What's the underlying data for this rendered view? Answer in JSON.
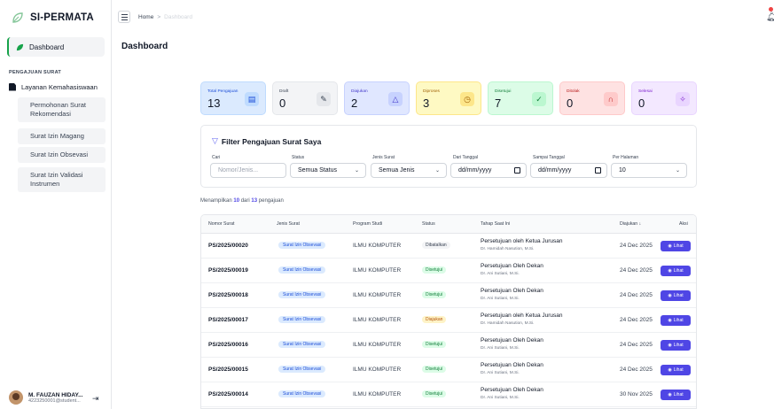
{
  "app": {
    "title": "SI-PERMATA"
  },
  "colors": {
    "primary": "#4f46e5",
    "brand": "#16a34a"
  },
  "sidebar": {
    "dashboard_label": "Dashboard",
    "section_label": "PENGAJUAN SURAT",
    "parent_label": "Layanan Kemahasiswaan",
    "sub_items": [
      {
        "label": "Permohonan Surat Rekomendasi"
      },
      {
        "label": "Surat Izin Magang"
      },
      {
        "label": "Surat Izin Obsevasi"
      },
      {
        "label": "Surat Izin Validasi Instrumen"
      }
    ],
    "user": {
      "name": "M. FAUZAN HIDAY...",
      "email": "4223250001@student..."
    }
  },
  "topbar": {
    "crumb_home": "Home",
    "crumb_sep": ">",
    "crumb_current": "Dashboard"
  },
  "page_title": "Dashboard",
  "stats": [
    {
      "label": "Total Pengajuan",
      "value": "13",
      "icon": "document-icon"
    },
    {
      "label": "Draft",
      "value": "0",
      "icon": "edit-icon"
    },
    {
      "label": "Diajukan",
      "value": "2",
      "icon": "warning-icon"
    },
    {
      "label": "Diproses",
      "value": "3",
      "icon": "clock-icon"
    },
    {
      "label": "Disetujui",
      "value": "7",
      "icon": "check-circle-icon"
    },
    {
      "label": "Ditolak",
      "value": "0",
      "icon": "reject-icon"
    },
    {
      "label": "Selesai",
      "value": "0",
      "icon": "sparkle-icon"
    }
  ],
  "filter": {
    "title": "Filter Pengajuan Surat Saya",
    "cari_label": "Cari",
    "cari_placeholder": "Nomor/Jenis...",
    "status_label": "Status",
    "status_value": "Semua Status",
    "jenis_label": "Jenis Surat",
    "jenis_value": "Semua Jenis",
    "dari_label": "Dari Tanggal",
    "dari_value": "dd/mm/yyyy",
    "sampai_label": "Sampai Tanggal",
    "sampai_value": "dd/mm/yyyy",
    "per_label": "Per Halaman",
    "per_value": "10"
  },
  "summary": {
    "prefix": "Menampilkan",
    "shown": "10",
    "mid": "dari",
    "total": "13",
    "suffix": "pengajuan"
  },
  "table": {
    "headers": [
      "Nomor Surat",
      "Jenis Surat",
      "Program Studi",
      "Status",
      "Tahap Saat Ini",
      "Diajukan ↓",
      "Aksi"
    ],
    "action_label": "Lihat",
    "rows": [
      {
        "no": "PS/2025/00020",
        "jenis": "Surat Izin Obsevasi",
        "prodi": "ILMU KOMPUTER",
        "status": "Dibatalkan",
        "tahap": "Persetujuan oleh Ketua Jurusan",
        "pj": "Dr. Hamidah Nasution, M.Si.",
        "tgl": "24 Dec 2025"
      },
      {
        "no": "PS/2025/00019",
        "jenis": "Surat Izin Obsevasi",
        "prodi": "ILMU KOMPUTER",
        "status": "Disetujui",
        "tahap": "Persetujuan Oleh Dekan",
        "pj": "Dr. Ani Sutiani, M.Si.",
        "tgl": "24 Dec 2025"
      },
      {
        "no": "PS/2025/00018",
        "jenis": "Surat Izin Obsevasi",
        "prodi": "ILMU KOMPUTER",
        "status": "Disetujui",
        "tahap": "Persetujuan Oleh Dekan",
        "pj": "Dr. Ani Sutiani, M.Si.",
        "tgl": "24 Dec 2025"
      },
      {
        "no": "PS/2025/00017",
        "jenis": "Surat Izin Obsevasi",
        "prodi": "ILMU KOMPUTER",
        "status": "Diajukan",
        "tahap": "Persetujuan oleh Ketua Jurusan",
        "pj": "Dr. Hamidah Nasution, M.Si.",
        "tgl": "24 Dec 2025"
      },
      {
        "no": "PS/2025/00016",
        "jenis": "Surat Izin Obsevasi",
        "prodi": "ILMU KOMPUTER",
        "status": "Disetujui",
        "tahap": "Persetujuan Oleh Dekan",
        "pj": "Dr. Ani Sutiani, M.Si.",
        "tgl": "24 Dec 2025"
      },
      {
        "no": "PS/2025/00015",
        "jenis": "Surat Izin Obsevasi",
        "prodi": "ILMU KOMPUTER",
        "status": "Disetujui",
        "tahap": "Persetujuan Oleh Dekan",
        "pj": "Dr. Ani Sutiani, M.Si.",
        "tgl": "24 Dec 2025"
      },
      {
        "no": "PS/2025/00014",
        "jenis": "Surat Izin Obsevasi",
        "prodi": "ILMU KOMPUTER",
        "status": "Disetujui",
        "tahap": "Persetujuan Oleh Dekan",
        "pj": "Dr. Ani Sutiani, M.Si.",
        "tgl": "30 Nov 2025"
      }
    ]
  }
}
